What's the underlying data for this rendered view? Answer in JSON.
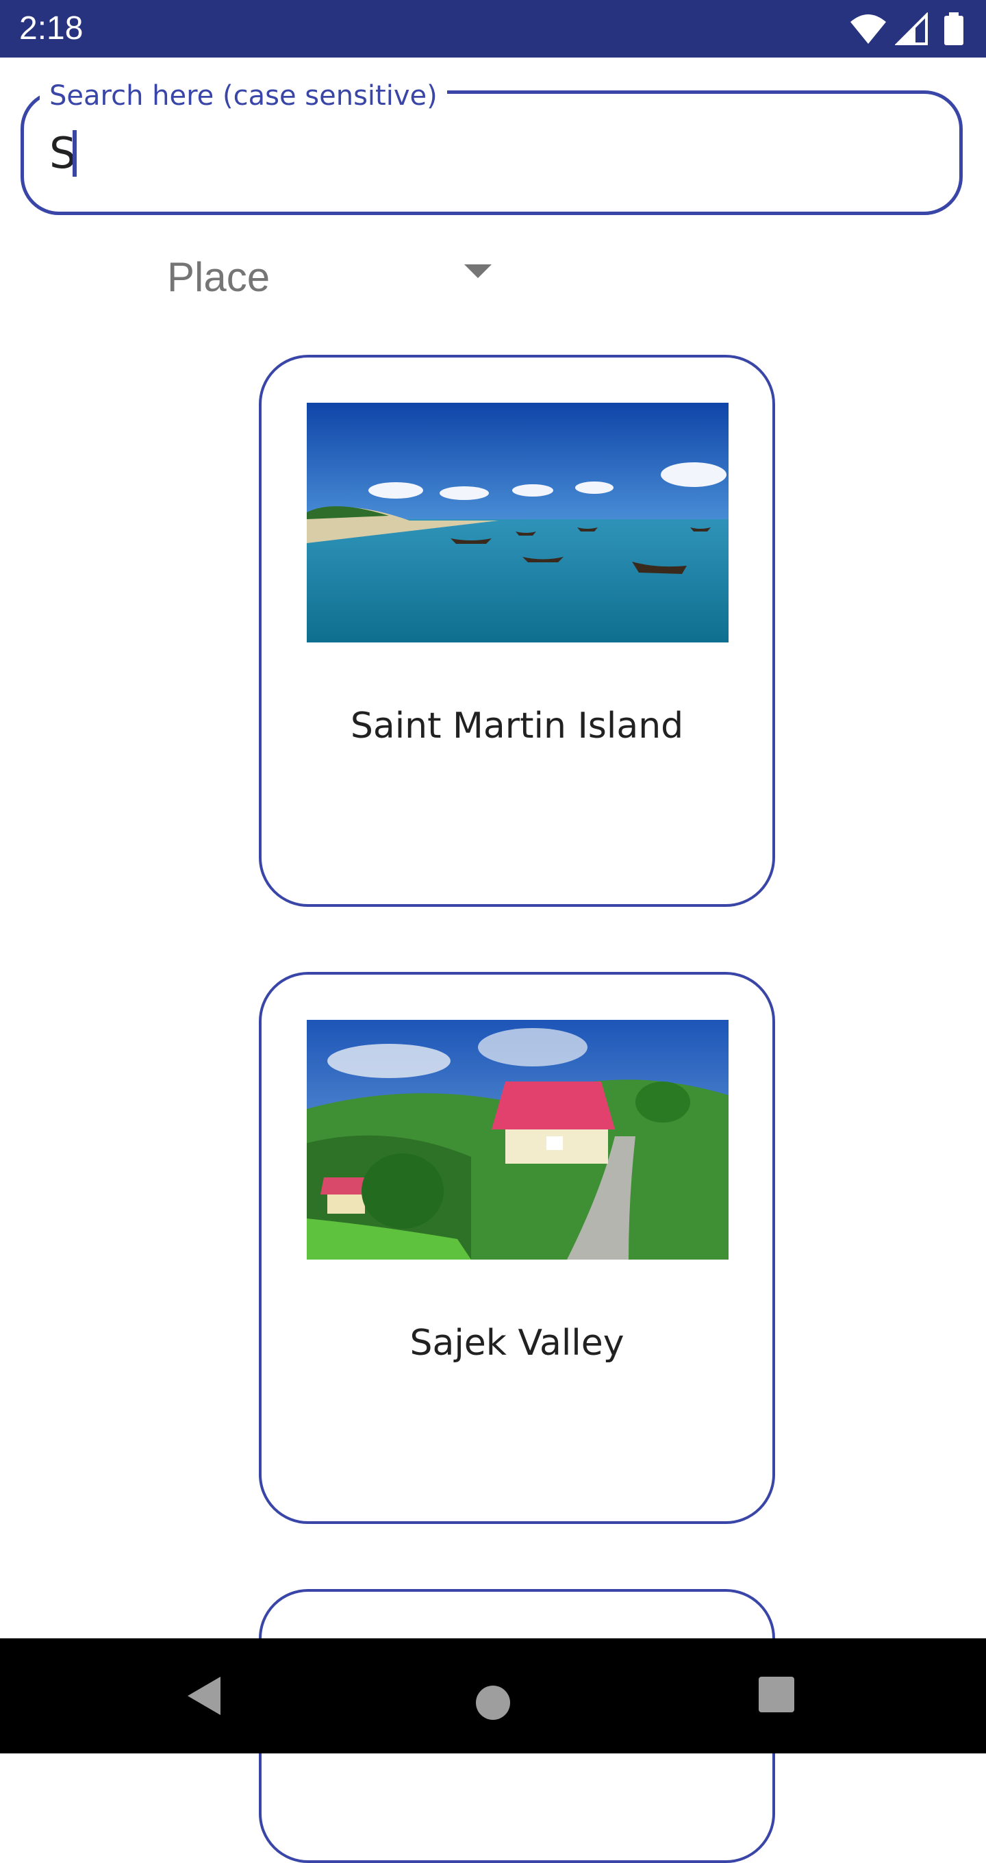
{
  "status_bar": {
    "time": "2:18",
    "icons": [
      "wifi-icon",
      "signal-icon",
      "battery-icon"
    ],
    "background": "#283380"
  },
  "search": {
    "label": "Search here (case sensitive)",
    "value": "S",
    "accent_color": "#3946a7"
  },
  "filter": {
    "selected": "Place",
    "icon": "dropdown-arrow-icon"
  },
  "places": [
    {
      "title": "Saint Martin Island",
      "image": "beach-with-boats-photo"
    },
    {
      "title": "Sajek Valley",
      "image": "hill-resort-red-roof-photo"
    },
    {
      "title": "",
      "image": ""
    }
  ],
  "nav_bar": {
    "icons": [
      "back-icon",
      "home-icon",
      "recents-icon"
    ]
  }
}
